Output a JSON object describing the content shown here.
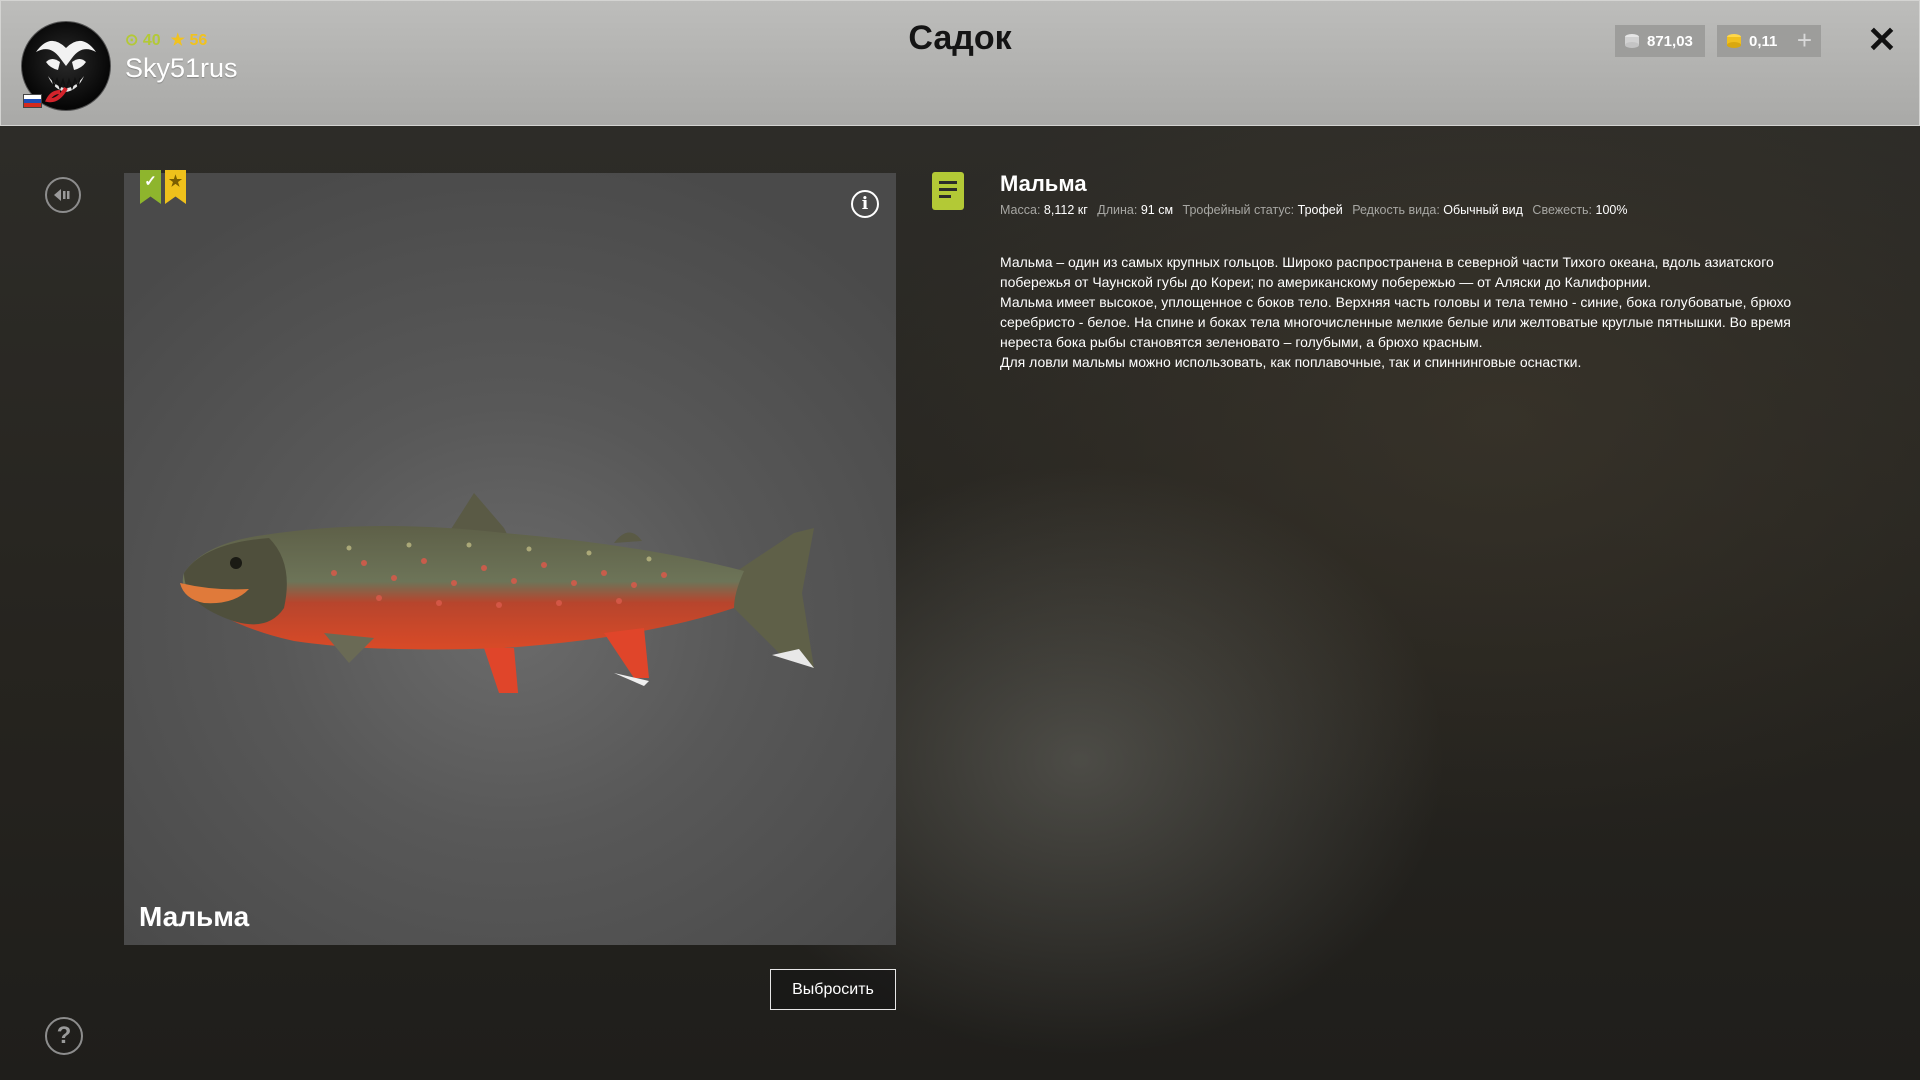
{
  "header": {
    "title": "Садок",
    "user": {
      "name": "Sky51rus",
      "level": "40",
      "rank": "56"
    },
    "currency": {
      "silver": "871,03",
      "gold": "0,11",
      "add_label": "+"
    },
    "close_label": "✕"
  },
  "fish_card": {
    "name": "Мальма",
    "release_label": "Выбросить",
    "info_label": "i"
  },
  "details": {
    "title": "Мальма",
    "properties": [
      {
        "key": "Масса:",
        "value": "8,112 кг"
      },
      {
        "key": "Длина:",
        "value": "91 см"
      },
      {
        "key": "Трофейный статус:",
        "value": "Трофей"
      },
      {
        "key": "Редкость вида:",
        "value": "Обычный вид"
      },
      {
        "key": "Свежесть:",
        "value": "100%"
      }
    ],
    "description": [
      "Мальма – один из самых крупных гольцов. Широко распространена в северной части Тихого океана, вдоль азиатского побережья от Чаунской губы до Кореи; по американскому побережью — от Аляски до Калифорнии.",
      "Мальма имеет высокое, уплощенное с боков тело. Верхняя часть головы и тела темно - синие, бока голубоватые, брюхо серебристо - белое. На спине и боках тела многочисленные мелкие белые или желтоватые круглые пятнышки. Во время нереста бока рыбы становятся зеленовато – голубыми, а брюхо красным.",
      "Для ловли мальмы можно использовать, как поплавочные, так и спиннинговые оснастки."
    ]
  },
  "help_label": "?",
  "colors": {
    "accent_green": "#b3c936",
    "accent_gold": "#efc11b",
    "header_bg": "#b3b3b1"
  },
  "icons": {
    "back": "back-arrow-icon",
    "help": "question-icon",
    "info": "info-icon",
    "note": "note-icon",
    "trophy": "trophy-badge-icon",
    "star": "star-badge-icon"
  }
}
